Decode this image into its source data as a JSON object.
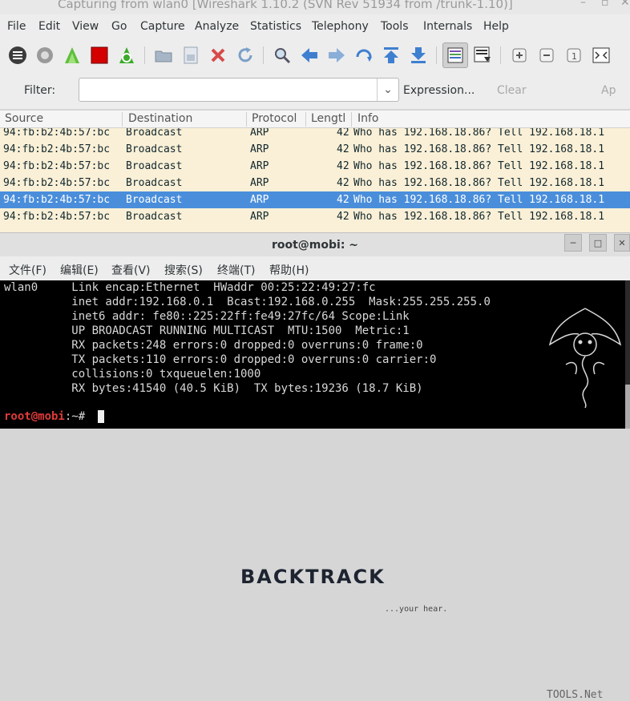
{
  "window": {
    "title": "Capturing from wlan0   [Wireshark 1.10.2  (SVN Rev 51934 from /trunk-1.10)]"
  },
  "menu": [
    "File",
    "Edit",
    "View",
    "Go",
    "Capture",
    "Analyze",
    "Statistics",
    "Telephony",
    "Tools",
    "Internals",
    "Help"
  ],
  "toolbar": {
    "icons": [
      "interface-list-icon",
      "capture-options-icon",
      "start-capture-icon",
      "stop-capture-icon",
      "restart-capture-icon",
      "open-file-icon",
      "save-file-icon",
      "close-file-icon",
      "reload-icon",
      "find-packet-icon",
      "go-back-icon",
      "go-forward-icon",
      "go-to-packet-icon",
      "go-first-icon",
      "go-last-icon",
      "colorize-icon",
      "auto-scroll-icon",
      "zoom-in-icon",
      "zoom-out-icon",
      "normal-size-icon",
      "resize-columns-icon"
    ]
  },
  "filter": {
    "label": "Filter:",
    "value": "",
    "expression_label": "Expression...",
    "clear_label": "Clear",
    "apply_label": "Ap"
  },
  "packet_list": {
    "columns": [
      "Source",
      "Destination",
      "Protocol",
      "Lengtl",
      "Info"
    ],
    "rows": [
      {
        "source": "94:fb:b2:4b:57:bc",
        "destination": "Broadcast",
        "protocol": "ARP",
        "length": "42",
        "info": "Who has 192.168.18.86?  Tell 192.168.18.1"
      },
      {
        "source": "94:fb:b2:4b:57:bc",
        "destination": "Broadcast",
        "protocol": "ARP",
        "length": "42",
        "info": "Who has 192.168.18.86?  Tell 192.168.18.1"
      },
      {
        "source": "94:fb:b2:4b:57:bc",
        "destination": "Broadcast",
        "protocol": "ARP",
        "length": "42",
        "info": "Who has 192.168.18.86?  Tell 192.168.18.1"
      },
      {
        "source": "94:fb:b2:4b:57:bc",
        "destination": "Broadcast",
        "protocol": "ARP",
        "length": "42",
        "info": "Who has 192.168.18.86?  Tell 192.168.18.1"
      },
      {
        "source": "94:fb:b2:4b:57:bc",
        "destination": "Broadcast",
        "protocol": "ARP",
        "length": "42",
        "info": "Who has 192.168.18.86?  Tell 192.168.18.1"
      },
      {
        "source": "94:fb:b2:4b:57:bc",
        "destination": "Broadcast",
        "protocol": "ARP",
        "length": "42",
        "info": "Who has 192.168.18.86?  Tell 192.168.18.1"
      }
    ],
    "selected_index": 4
  },
  "terminal": {
    "title": "root@mobi: ~",
    "menu": [
      "文件(F)",
      "编辑(E)",
      "查看(V)",
      "搜索(S)",
      "终端(T)",
      "帮助(H)"
    ],
    "lines": [
      "wlan0     Link encap:Ethernet  HWaddr 00:25:22:49:27:fc",
      "          inet addr:192.168.0.1  Bcast:192.168.0.255  Mask:255.255.255.0",
      "          inet6 addr: fe80::225:22ff:fe49:27fc/64 Scope:Link",
      "          UP BROADCAST RUNNING MULTICAST  MTU:1500  Metric:1",
      "          RX packets:248 errors:0 dropped:0 overruns:0 frame:0",
      "          TX packets:110 errors:0 dropped:0 overruns:0 carrier:0",
      "          collisions:0 txqueuelen:1000",
      "          RX bytes:41540 (40.5 KiB)  TX bytes:19236 (18.7 KiB)"
    ],
    "prompt_user": "root@mobi",
    "prompt_path": ":~#",
    "watermark": "BACKTRACK",
    "watermark_sub": "...your hear.",
    "site": "TOOLS.Net",
    "colors": {
      "prompt": "#e03a3a",
      "text": "#d8d8d8",
      "background": "#000000",
      "selected_row": "#4a8edb",
      "row": "#faf0d7"
    }
  }
}
